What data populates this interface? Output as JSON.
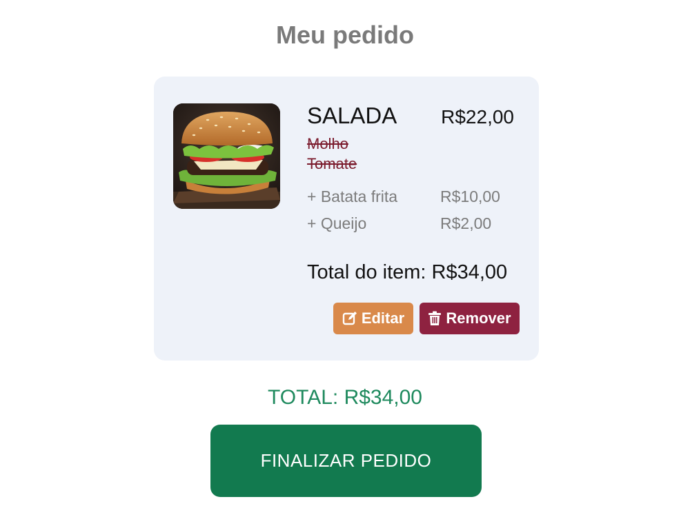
{
  "page": {
    "title": "Meu pedido"
  },
  "order_item": {
    "name": "SALADA",
    "price": "R$22,00",
    "image_alt": "burger-image",
    "removed_ingredients": [
      "Molho",
      "Tomate"
    ],
    "addons": [
      {
        "label": "+ Batata frita",
        "price": "R$10,00"
      },
      {
        "label": "+ Queijo",
        "price": "R$2,00"
      }
    ],
    "total_label": "Total do item: R$34,00",
    "edit_label": "Editar",
    "edit_icon": "edit-icon",
    "remove_label": "Remover",
    "remove_icon": "trash-icon"
  },
  "summary": {
    "total": "TOTAL: R$34,00",
    "finish_label": "FINALIZAR PEDIDO"
  },
  "colors": {
    "card_bg": "#eef2f9",
    "edit_button": "#d9894a",
    "remove_button": "#8e2240",
    "finish_button": "#127a4f",
    "total_text": "#1f8a5e",
    "removed_text": "#7a1a2c"
  }
}
